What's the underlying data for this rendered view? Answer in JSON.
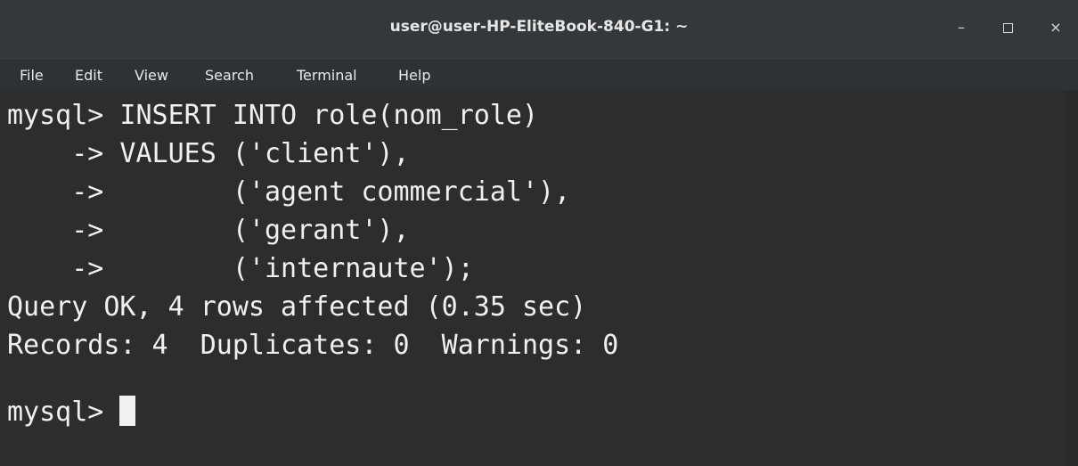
{
  "window": {
    "title": "user@user-HP-EliteBook-840-G1: ~",
    "controls": {
      "minimize": "–",
      "close": "×"
    }
  },
  "menu": [
    "File",
    "Edit",
    "View",
    "Search",
    "Terminal",
    "Help"
  ],
  "terminal": {
    "lines": [
      "mysql> INSERT INTO role(nom_role)",
      "    -> VALUES ('client'),",
      "    ->        ('agent commercial'),",
      "    ->        ('gerant'),",
      "    ->        ('internaute');",
      "Query OK, 4 rows affected (0.35 sec)",
      "Records: 4  Duplicates: 0  Warnings: 0",
      "",
      "mysql> "
    ]
  }
}
